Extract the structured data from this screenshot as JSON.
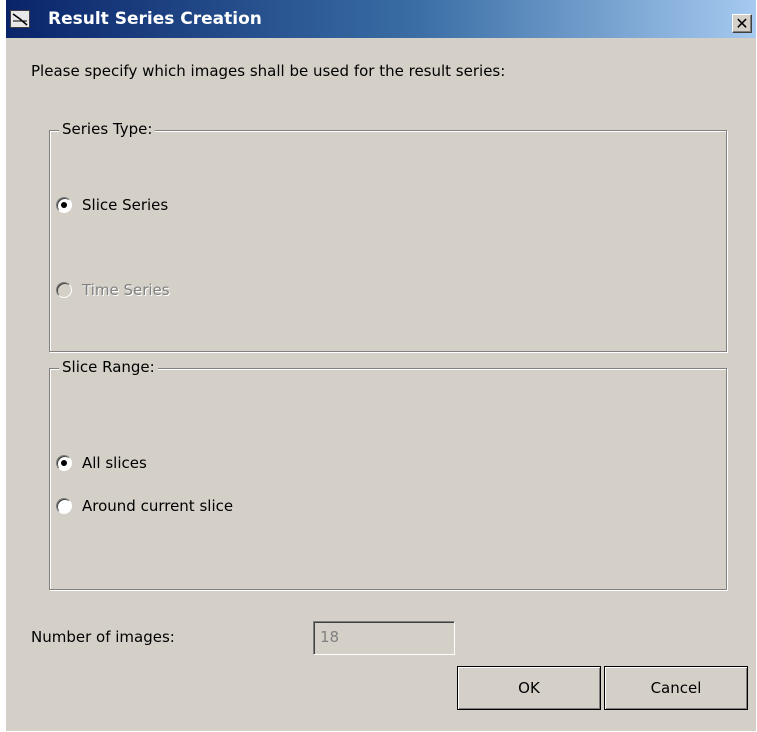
{
  "window": {
    "title": "Result Series Creation",
    "close_symbol": "✕",
    "icon": "app-icon"
  },
  "instruction": "Please specify which images shall be used for the result series:",
  "series_type": {
    "legend": "Series Type:",
    "options": [
      {
        "label": "Slice Series",
        "checked": true,
        "enabled": true
      },
      {
        "label": "Time Series",
        "checked": false,
        "enabled": false
      }
    ]
  },
  "slice_range": {
    "legend": "Slice Range:",
    "options": [
      {
        "label": "All slices",
        "checked": true,
        "enabled": true
      },
      {
        "label": "Around current slice",
        "checked": false,
        "enabled": true
      }
    ]
  },
  "number_of_images": {
    "label": "Number of images:",
    "value": "18",
    "enabled": false
  },
  "buttons": {
    "ok": "OK",
    "cancel": "Cancel"
  },
  "colors": {
    "title_gradient_start": "#0a246a",
    "title_gradient_end": "#a6caf0",
    "dialog_face": "#d4d0c8",
    "disabled_text": "#808080"
  }
}
